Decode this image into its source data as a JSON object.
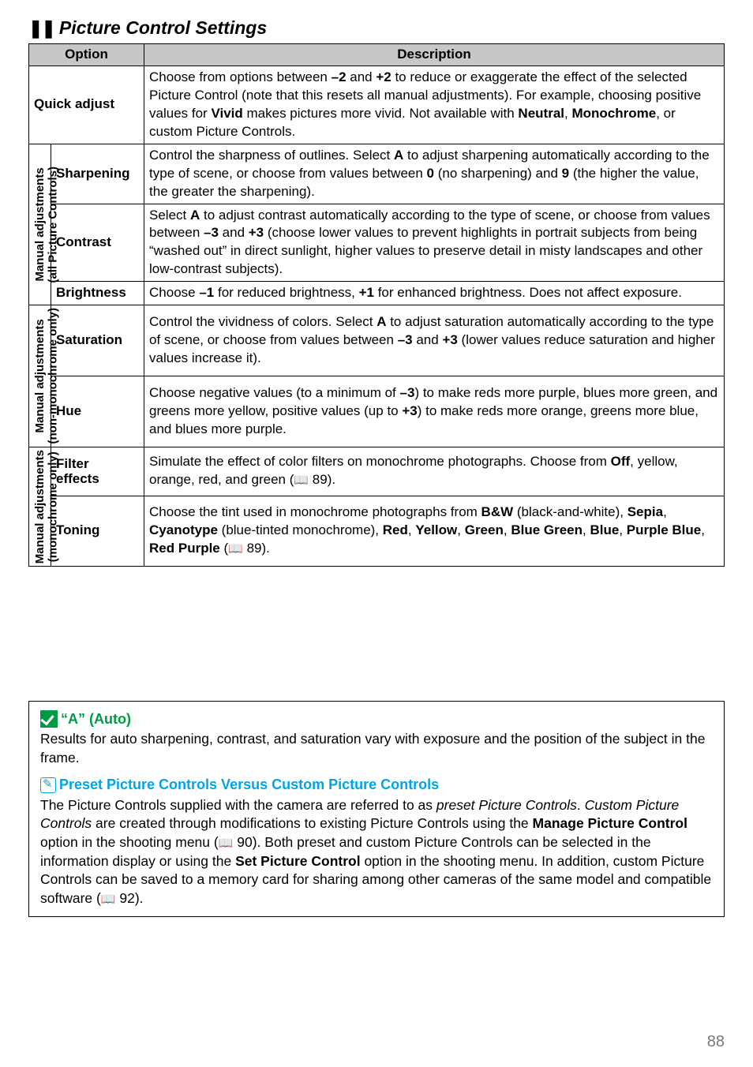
{
  "heading": "Picture Control Settings",
  "table": {
    "headers": {
      "option": "Option",
      "description": "Description"
    },
    "quick_adjust": {
      "label": "Quick adjust",
      "desc": "Choose from options between <b>–2</b> and <b>+2</b> to reduce or exaggerate the effect of the selected Picture Control (note that this resets all manual adjustments). For example, choosing positive values for <b>Vivid</b> makes pictures more vivid. Not available with <b>Neutral</b>, <b>Monochrome</b>, or custom Picture Controls."
    },
    "group_all": {
      "label": "Manual adjustments",
      "paren": "(all Picture Controls)",
      "rows": [
        {
          "opt": "Sharpening",
          "desc": "Control the sharpness of outlines.  Select <b>A</b> to adjust sharpening automatically according to the type of scene, or choose from values between <b>0</b> (no sharpening) and <b>9</b> (the higher the value, the greater the sharpening)."
        },
        {
          "opt": "Contrast",
          "desc": "Select <b>A</b> to adjust contrast automatically according to the type of scene, or choose from values between <b>–3</b> and <b>+3</b> (choose lower values to prevent highlights in portrait subjects from being &ldquo;washed out&rdquo; in direct sunlight, higher values to preserve detail in misty landscapes and other low-contrast subjects)."
        },
        {
          "opt": "Brightness",
          "desc": "Choose <b>–1</b> for reduced brightness, <b>+1</b> for enhanced brightness.  Does not affect exposure."
        }
      ]
    },
    "group_nonmono": {
      "label": "Manual adjustments",
      "paren": "(non-monochrome only)",
      "rows": [
        {
          "opt": "Saturation",
          "desc": "Control the vividness of colors.  Select <b>A</b> to adjust saturation automatically according to the type of scene, or choose from values between <b>–3</b> and <b>+3</b> (lower values reduce saturation and higher values increase it)."
        },
        {
          "opt": "Hue",
          "desc": "Choose negative values (to a minimum of <b>–3</b>) to make reds more purple, blues more green, and greens more yellow, positive values (up to <b>+3</b>) to make reds more orange, greens more blue, and blues more purple."
        }
      ]
    },
    "group_mono": {
      "label": "Manual adjustments",
      "paren": "(monochrome only)",
      "rows": [
        {
          "opt": "Filter effects",
          "desc": "Simulate the effect of color filters on monochrome photographs.  Choose from <b>Off</b>, yellow, orange, red, and green (<span class='ref-icon'>&#128214;</span> 89)."
        },
        {
          "opt": "Toning",
          "desc": "Choose the tint used in monochrome photographs from <b>B&amp;W</b> (black-and-white), <b>Sepia</b>, <b>Cyanotype</b> (blue-tinted monochrome), <b>Red</b>, <b>Yellow</b>, <b>Green</b>, <b>Blue Green</b>, <b>Blue</b>, <b>Purple Blue</b>, <b>Red Purple</b> (<span class='ref-icon'>&#128214;</span> 89)."
        }
      ]
    }
  },
  "notes": {
    "a_auto": {
      "title": "“A” (Auto)",
      "body": "Results for auto sharpening, contrast, and saturation vary with exposure and the position of the subject in the frame."
    },
    "preset": {
      "title": "Preset Picture Controls Versus Custom Picture Controls",
      "body": "The Picture Controls supplied with the camera are referred to as <i class='term'>preset Picture Controls</i>. <i class='term'>Custom Picture Controls</i> are created through modifications to existing Picture Controls using the <b>Manage Picture Control</b> option in the shooting menu (<span class='ref-icon'>&#128214;</span> 90).  Both preset and custom Picture Controls can be selected in the information display or using the <b>Set Picture Control</b> option in the shooting menu.  In addition, custom Picture Controls can be saved to a memory card for sharing among other cameras of the same model and compatible software (<span class='ref-icon'>&#128214;</span> 92)."
    }
  },
  "page_number": "88"
}
